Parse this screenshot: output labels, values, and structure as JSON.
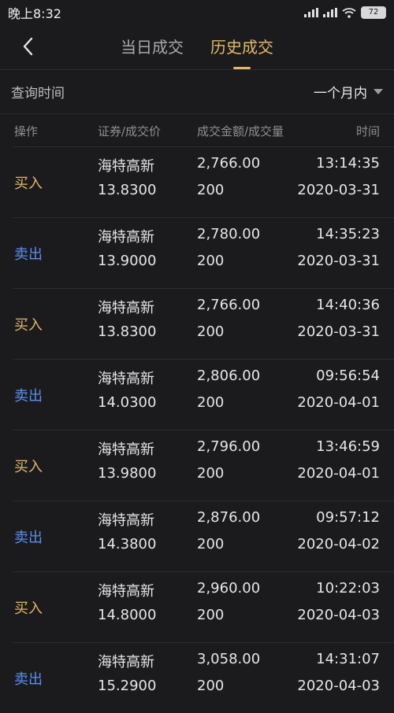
{
  "status": {
    "time": "晚上8:32",
    "indicators": "HD ▮▮▮ ▮▮▮ wifi",
    "battery": "72"
  },
  "nav": {
    "tabs": [
      {
        "label": "当日成交",
        "active": false
      },
      {
        "label": "历史成交",
        "active": true
      }
    ]
  },
  "filter": {
    "label": "查询时间",
    "period": "一个月内"
  },
  "table": {
    "headers": [
      "操作",
      "证券/成交价",
      "成交金额/成交量",
      "时间"
    ],
    "rows": [
      {
        "op": "买入",
        "side": "buy",
        "name": "海特高新",
        "price": "13.8300",
        "amount": "2,766.00",
        "qty": "200",
        "time": "13:14:35",
        "date": "2020-03-31"
      },
      {
        "op": "卖出",
        "side": "sell",
        "name": "海特高新",
        "price": "13.9000",
        "amount": "2,780.00",
        "qty": "200",
        "time": "14:35:23",
        "date": "2020-03-31"
      },
      {
        "op": "买入",
        "side": "buy",
        "name": "海特高新",
        "price": "13.8300",
        "amount": "2,766.00",
        "qty": "200",
        "time": "14:40:36",
        "date": "2020-03-31"
      },
      {
        "op": "卖出",
        "side": "sell",
        "name": "海特高新",
        "price": "14.0300",
        "amount": "2,806.00",
        "qty": "200",
        "time": "09:56:54",
        "date": "2020-04-01"
      },
      {
        "op": "买入",
        "side": "buy",
        "name": "海特高新",
        "price": "13.9800",
        "amount": "2,796.00",
        "qty": "200",
        "time": "13:46:59",
        "date": "2020-04-01"
      },
      {
        "op": "卖出",
        "side": "sell",
        "name": "海特高新",
        "price": "14.3800",
        "amount": "2,876.00",
        "qty": "200",
        "time": "09:57:12",
        "date": "2020-04-02"
      },
      {
        "op": "买入",
        "side": "buy",
        "name": "海特高新",
        "price": "14.8000",
        "amount": "2,960.00",
        "qty": "200",
        "time": "10:22:03",
        "date": "2020-04-03"
      },
      {
        "op": "卖出",
        "side": "sell",
        "name": "海特高新",
        "price": "15.2900",
        "amount": "3,058.00",
        "qty": "200",
        "time": "14:31:07",
        "date": "2020-04-03"
      }
    ]
  },
  "colors": {
    "buy": "#e2b86b",
    "sell": "#5b8ff0",
    "accent": "#e2b86b",
    "background": "#1b1b1d"
  }
}
